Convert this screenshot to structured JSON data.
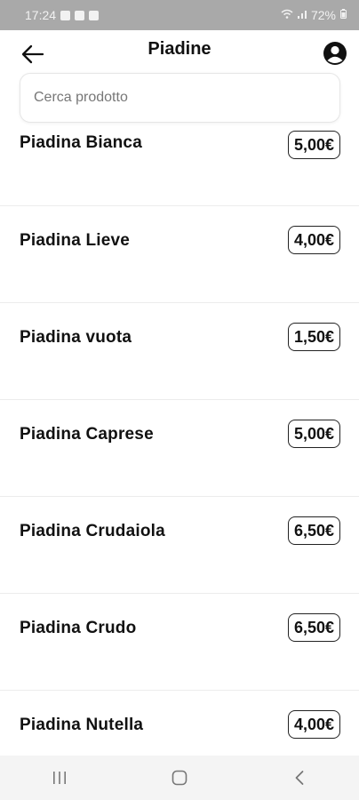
{
  "status_bar": {
    "time": "17:24",
    "battery": "72%",
    "left_icons": [
      "photo-icon",
      "check-icon",
      "calendar-icon"
    ],
    "right_icons": [
      "wifi-icon",
      "signal-icon",
      "battery-icon"
    ]
  },
  "header": {
    "title": "Piadine",
    "back_icon": "arrow-left-icon",
    "profile_icon": "account-icon"
  },
  "search": {
    "placeholder": "Cerca prodotto",
    "value": ""
  },
  "products": [
    {
      "name": "Piadina Bianca",
      "price": "5,00€"
    },
    {
      "name": "Piadina Lieve",
      "price": "4,00€"
    },
    {
      "name": "Piadina vuota",
      "price": "1,50€"
    },
    {
      "name": "Piadina Caprese",
      "price": "5,00€"
    },
    {
      "name": "Piadina Crudaiola",
      "price": "6,50€"
    },
    {
      "name": "Piadina Crudo",
      "price": "6,50€"
    },
    {
      "name": "Piadina Nutella",
      "price": "4,00€"
    }
  ],
  "nav_bar": {
    "icons": [
      "recent-apps-icon",
      "home-icon",
      "back-nav-icon"
    ]
  },
  "colors": {
    "status_bar_bg": "#a9a9a9",
    "text_primary": "#111111",
    "divider": "#ececec",
    "nav_bar_bg": "#f4f4f4"
  }
}
